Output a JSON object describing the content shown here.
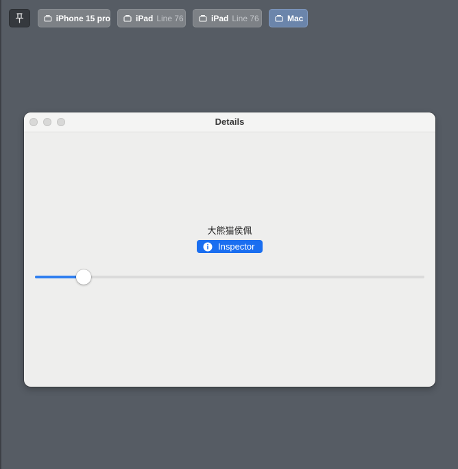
{
  "toolbar": {
    "pin_icon": "pin-icon",
    "previews": [
      {
        "name": "iPhone 15 pro",
        "sub": "",
        "icon": "device-icon",
        "selected": false
      },
      {
        "name": "iPad",
        "sub": "Line 76",
        "icon": "device-icon",
        "selected": false
      },
      {
        "name": "iPad",
        "sub": "Line 76",
        "icon": "device-icon",
        "selected": false
      },
      {
        "name": "Mac",
        "sub": "",
        "icon": "device-icon",
        "selected": true
      }
    ]
  },
  "window": {
    "title": "Details",
    "text": "大熊猫侯佩",
    "inspector_button": {
      "label": "Inspector",
      "icon": "info-circle-icon"
    },
    "slider": {
      "value": 0.125
    }
  },
  "colors": {
    "background": "#565c64",
    "accent": "#1a6ef0",
    "selected_preview": "#6b85ab"
  }
}
